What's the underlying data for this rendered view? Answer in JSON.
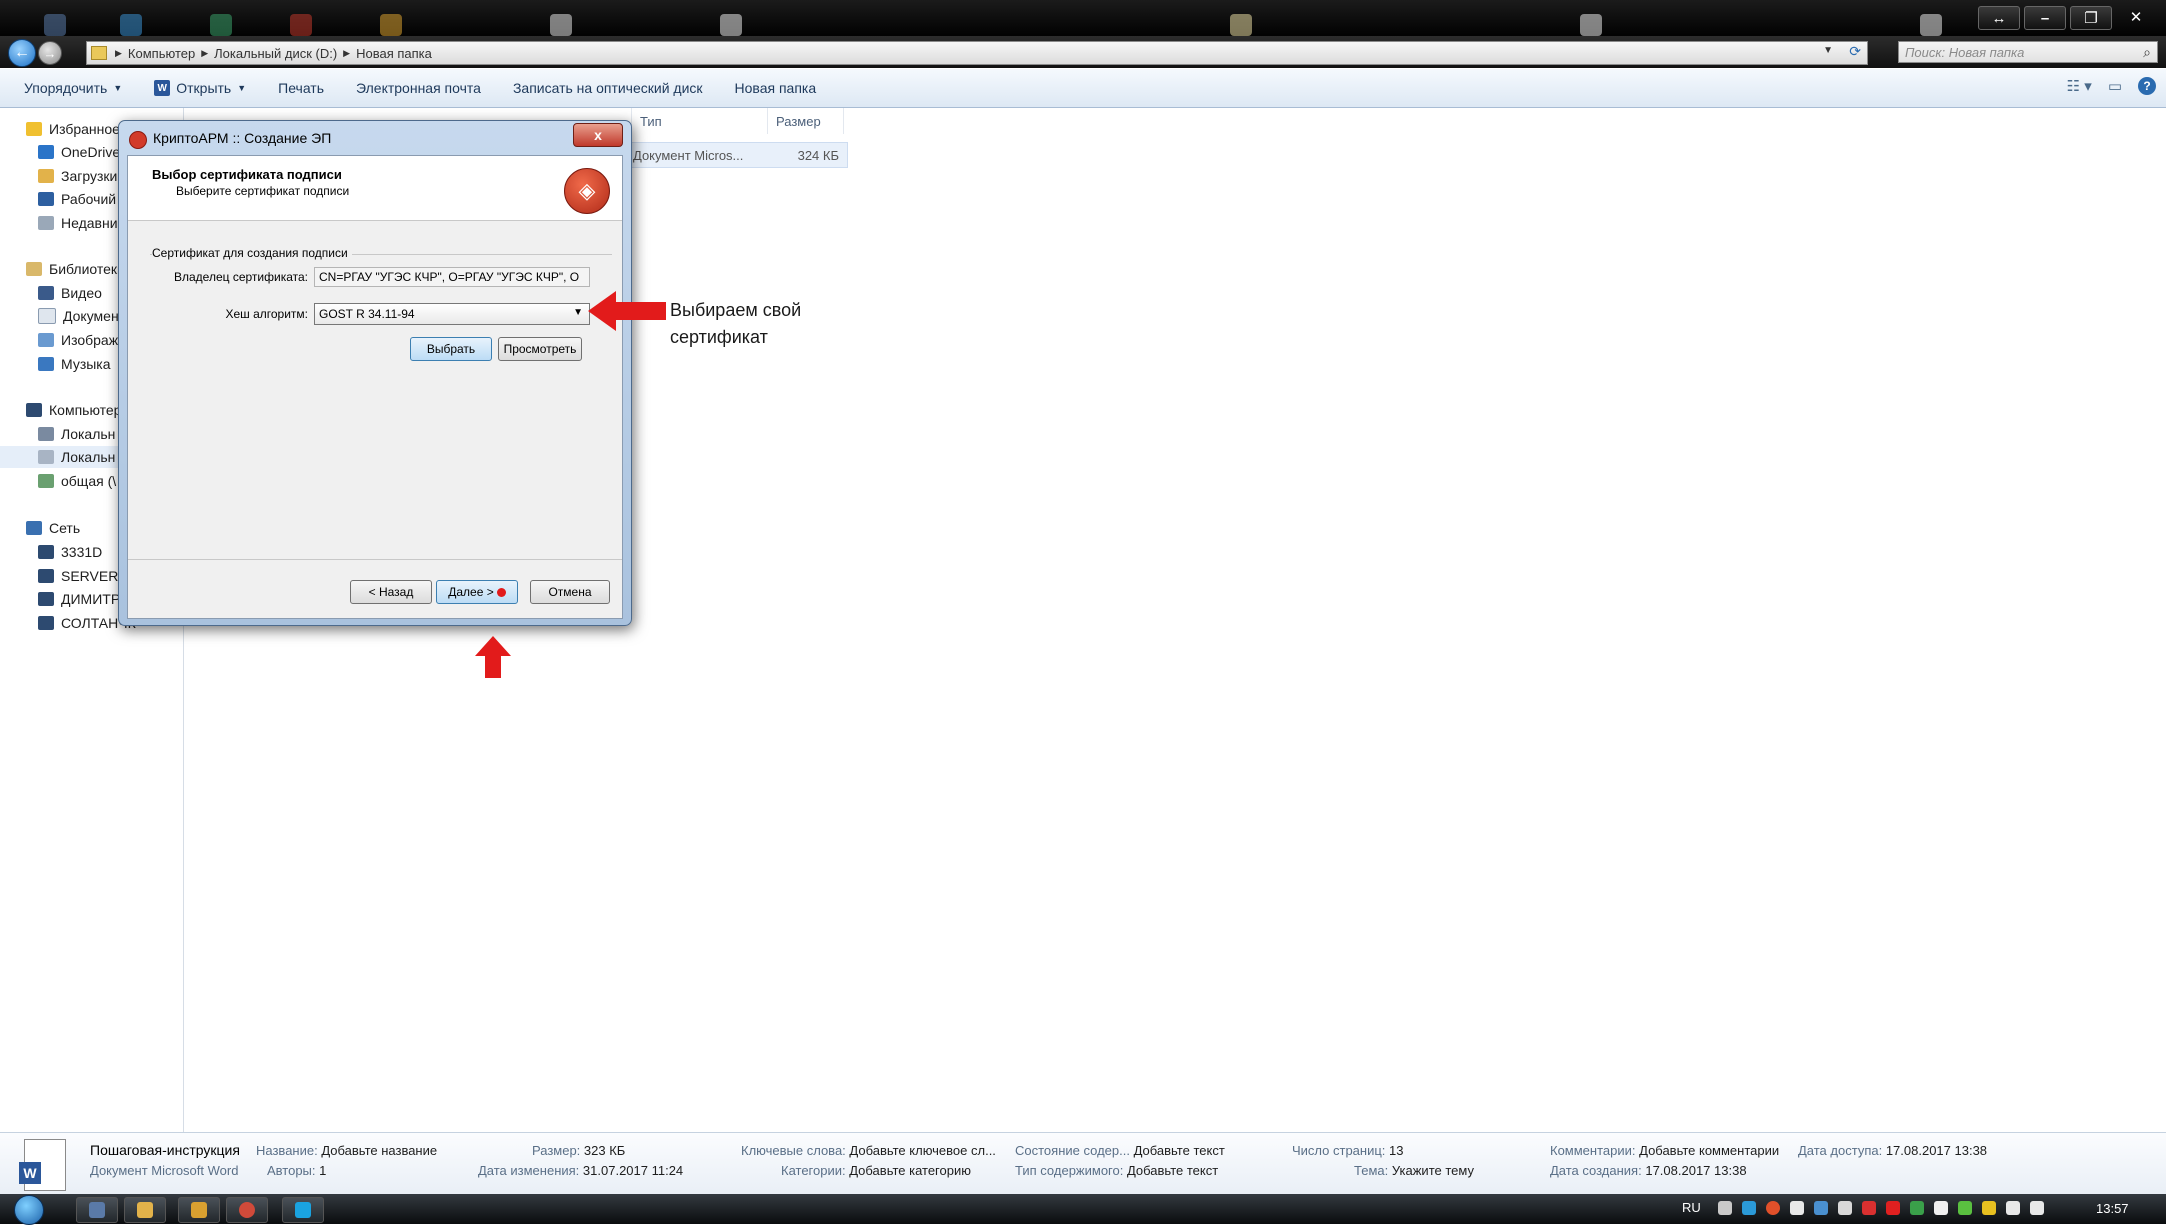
{
  "explorer": {
    "breadcrumb": [
      "Компьютер",
      "Локальный диск (D:)",
      "Новая папка"
    ],
    "search_placeholder": "Поиск: Новая папка",
    "toolbar": {
      "organize": "Упорядочить",
      "open": "Открыть",
      "print": "Печать",
      "email": "Электронная почта",
      "burn": "Записать на оптический диск",
      "new_folder": "Новая папка"
    },
    "nav": {
      "favorites": "Избранное",
      "onedrive": "OneDrive",
      "downloads": "Загрузки",
      "desktop": "Рабочий",
      "recent": "Недавние",
      "libraries": "Библиотеки",
      "videos": "Видео",
      "documents": "Докумен",
      "pictures": "Изображ",
      "music": "Музыка",
      "computer": "Компьютер",
      "local1": "Локальн",
      "local2": "Локальн",
      "shared": "общая (\\",
      "network": "Сеть",
      "pc1": "3331D",
      "pc2": "SERVER",
      "pc3": "ДИМИТР",
      "pc4": "СОЛТАНЧК"
    },
    "columns": {
      "type": "Тип",
      "size": "Размер"
    },
    "file": {
      "type": "Документ Micros...",
      "size": "324 КБ"
    }
  },
  "dialog": {
    "title": "КриптоАРМ :: Создание ЭП",
    "close": "x",
    "header_title": "Выбор сертификата подписи",
    "header_subtitle": "Выберите сертификат подписи",
    "group_label": "Сертификат для создания подписи",
    "owner_label": "Владелец сертификата:",
    "owner_value": "CN=РГАУ \"УГЭС КЧР\", O=РГАУ \"УГЭС КЧР\", O",
    "hash_label": "Хеш алгоритм:",
    "hash_value": "GOST R 34.11-94",
    "select_button": "Выбрать",
    "view_button": "Просмотреть",
    "back_button": "< Назад",
    "next_button": "Далее >",
    "cancel_button": "Отмена"
  },
  "annotation": {
    "text": "Выбираем свой\nсертификат",
    "color": "#e21b1b"
  },
  "details": {
    "file_name": "Пошаговая-инструкция",
    "file_type": "Документ Microsoft Word",
    "title_label": "Название:",
    "title_value": "Добавьте название",
    "authors_label": "Авторы:",
    "authors_value": "1",
    "size_label": "Размер:",
    "size_value": "323 КБ",
    "modified_label": "Дата изменения:",
    "modified_value": "31.07.2017 11:24",
    "keywords_label": "Ключевые слова:",
    "keywords_value": "Добавьте ключевое сл...",
    "categories_label": "Категории:",
    "categories_value": "Добавьте категорию",
    "status_label": "Состояние содер...",
    "status_value": "Добавьте текст",
    "content_type_label": "Тип содержимого:",
    "content_type_value": "Добавьте текст",
    "pages_label": "Число страниц:",
    "pages_value": "13",
    "subject_label": "Тема:",
    "subject_value": "Укажите тему",
    "comments_label": "Комментарии:",
    "comments_value": "Добавьте комментарии",
    "accessed_label": "Дата доступа:",
    "accessed_value": "17.08.2017 13:38",
    "created_label": "Дата создания:",
    "created_value": "17.08.2017 13:38"
  },
  "taskbar": {
    "lang": "RU",
    "clock": "13:57"
  }
}
